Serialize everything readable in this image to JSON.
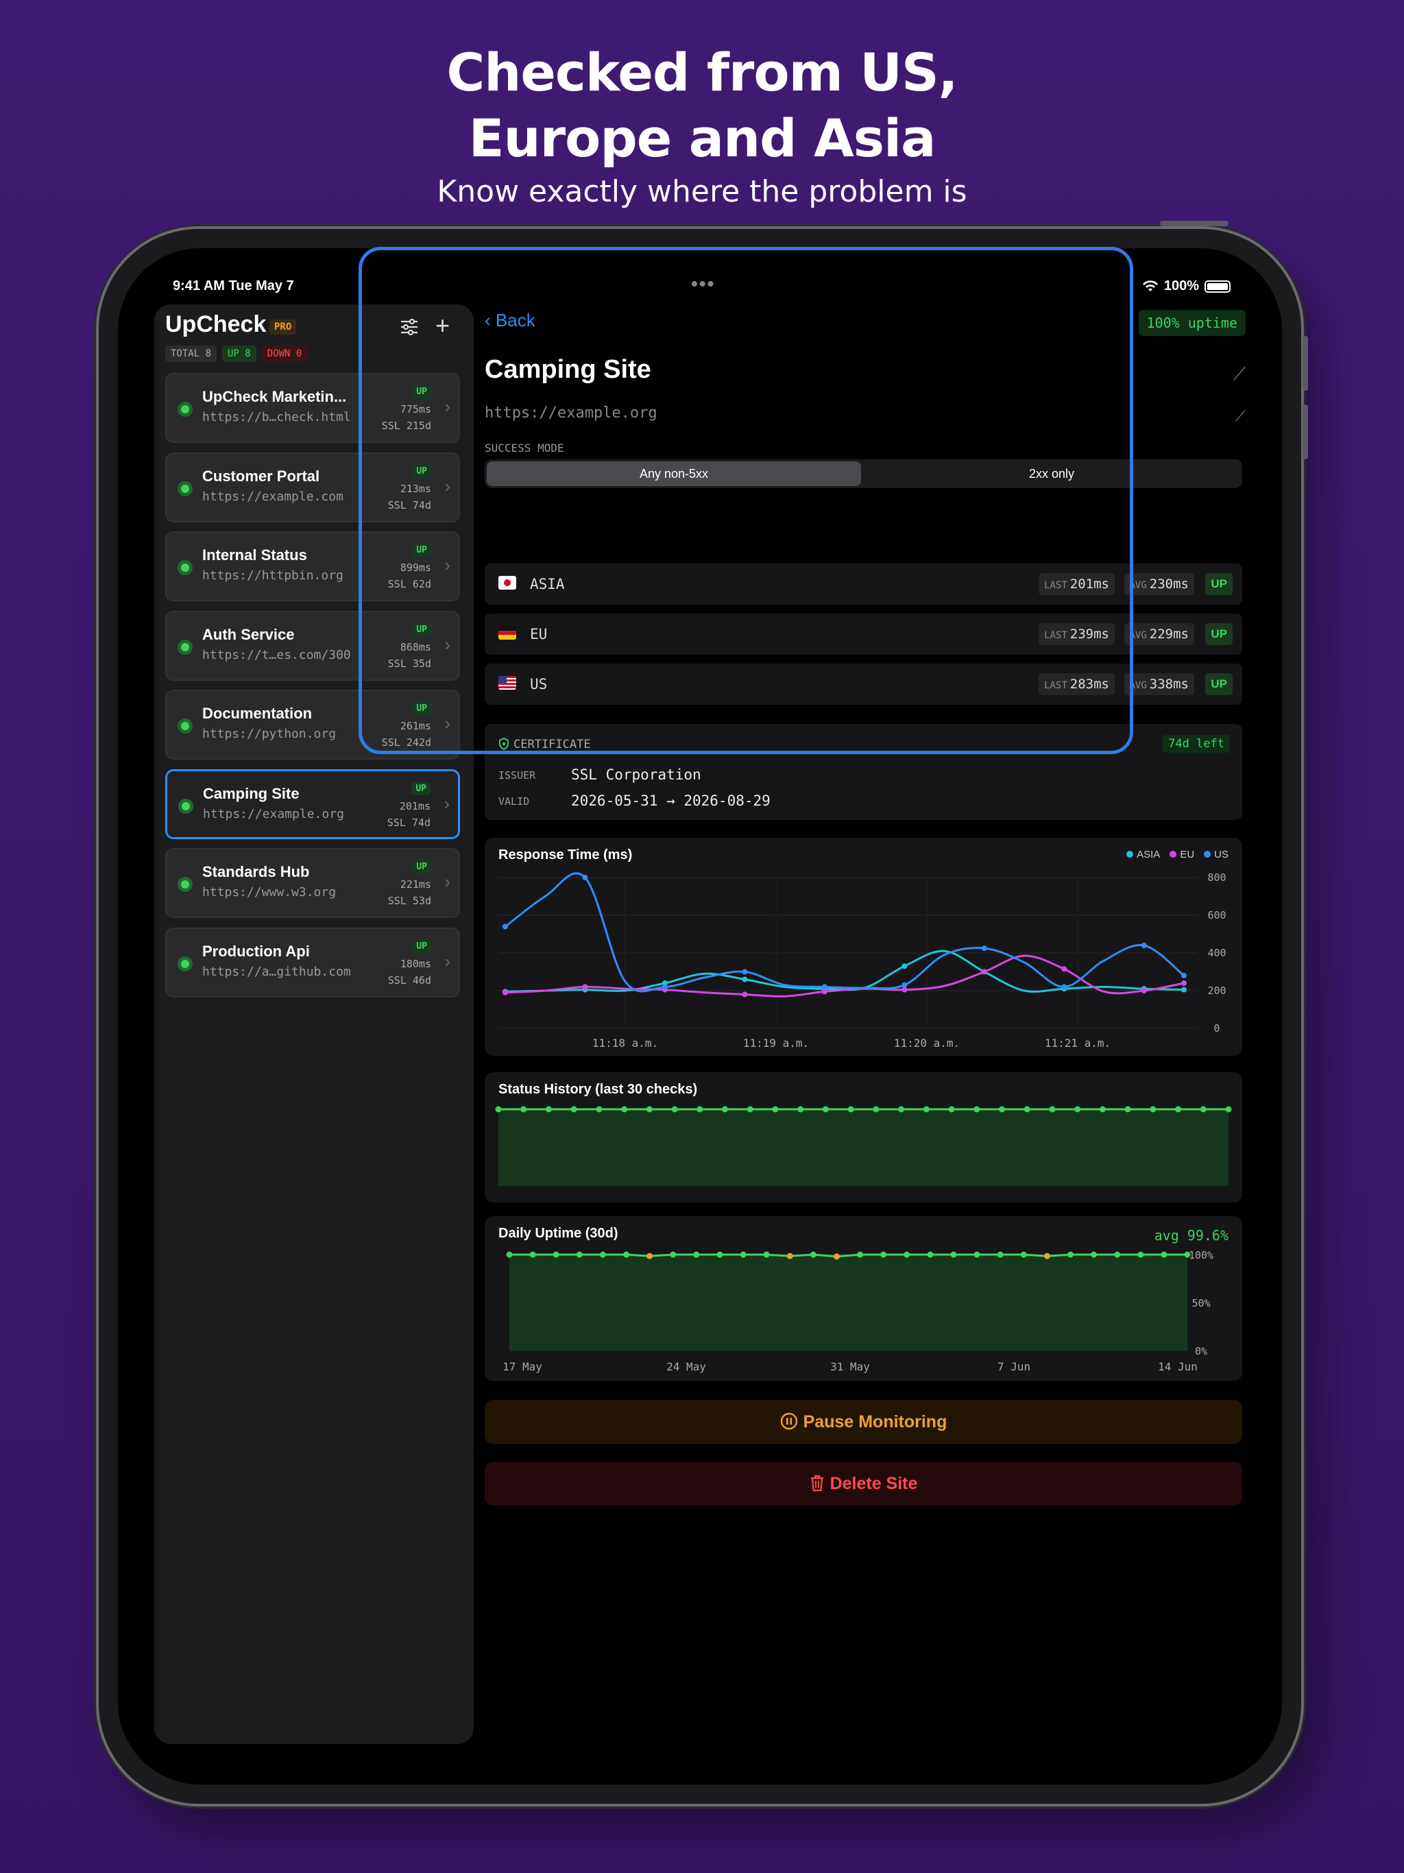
{
  "marketing": {
    "headline_line1": "Checked from US,",
    "headline_line2": "Europe and Asia",
    "subline": "Know exactly where the problem is"
  },
  "status_bar": {
    "time": "9:41 AM  Tue May 7",
    "battery": "100%"
  },
  "sidebar": {
    "title": "UpCheck",
    "badge": "PRO",
    "pills": {
      "total": "TOTAL 8",
      "up": "UP 8",
      "down": "DOWN 0"
    },
    "sites": [
      {
        "name": "UpCheck Marketin...",
        "url": "https://b…check.html",
        "status": "UP",
        "ms": "775ms",
        "ssl": "SSL 215d"
      },
      {
        "name": "Customer Portal",
        "url": "https://example.com",
        "status": "UP",
        "ms": "213ms",
        "ssl": "SSL 74d"
      },
      {
        "name": "Internal Status",
        "url": "https://httpbin.org",
        "status": "UP",
        "ms": "899ms",
        "ssl": "SSL 62d"
      },
      {
        "name": "Auth Service",
        "url": "https://t…es.com/300",
        "status": "UP",
        "ms": "868ms",
        "ssl": "SSL 35d"
      },
      {
        "name": "Documentation",
        "url": "https://python.org",
        "status": "UP",
        "ms": "261ms",
        "ssl": "SSL 242d"
      },
      {
        "name": "Camping Site",
        "url": "https://example.org",
        "status": "UP",
        "ms": "201ms",
        "ssl": "SSL 74d"
      },
      {
        "name": "Standards Hub",
        "url": "https://www.w3.org",
        "status": "UP",
        "ms": "221ms",
        "ssl": "SSL 53d"
      },
      {
        "name": "Production Api",
        "url": "https://a…github.com",
        "status": "UP",
        "ms": "180ms",
        "ssl": "SSL 46d"
      }
    ]
  },
  "detail": {
    "back_label": "Back",
    "uptime_badge": "100% uptime",
    "title": "Camping Site",
    "url": "https://example.org",
    "success_mode_label": "SUCCESS MODE",
    "success_mode_options": [
      "Any non-5xx",
      "2xx only"
    ],
    "regions": [
      {
        "name": "ASIA",
        "last_label": "LAST",
        "last": "201ms",
        "avg_label": "AVG",
        "avg": "230ms",
        "status": "UP"
      },
      {
        "name": "EU",
        "last_label": "LAST",
        "last": "239ms",
        "avg_label": "AVG",
        "avg": "229ms",
        "status": "UP"
      },
      {
        "name": "US",
        "last_label": "LAST",
        "last": "283ms",
        "avg_label": "AVG",
        "avg": "338ms",
        "status": "UP"
      }
    ],
    "certificate": {
      "label": "CERTIFICATE",
      "days_left": "74d left",
      "issuer_label": "ISSUER",
      "issuer": "SSL Corporation",
      "valid_label": "VALID",
      "valid": "2026-05-31 → 2026-08-29"
    },
    "pause_label": "Pause Monitoring",
    "delete_label": "Delete Site"
  },
  "colors": {
    "accent": "#2f8ef5",
    "up": "#3ed45e",
    "asia": "#1fc6d6",
    "eu": "#d648e6",
    "us": "#2f8ef5",
    "orange": "#f0a030",
    "red": "#ff4b4b"
  },
  "chart_data": [
    {
      "type": "line",
      "title": "Response Time (ms)",
      "ylim": [
        0,
        800
      ],
      "yticks": [
        0,
        200,
        400,
        600,
        800
      ],
      "xtick_labels": [
        "11:18 a.m.",
        "11:19 a.m.",
        "11:20 a.m.",
        "11:21 a.m."
      ],
      "legend": "top-right",
      "series": [
        {
          "name": "ASIA",
          "color": "#1fc6d6",
          "values": [
            195,
            200,
            205,
            200,
            240,
            290,
            260,
            220,
            210,
            215,
            330,
            410,
            300,
            200,
            210,
            220,
            210,
            205
          ]
        },
        {
          "name": "EU",
          "color": "#d648e6",
          "values": [
            190,
            200,
            220,
            210,
            205,
            190,
            180,
            170,
            195,
            210,
            205,
            225,
            300,
            385,
            315,
            195,
            200,
            240
          ]
        },
        {
          "name": "US",
          "color": "#2f8ef5",
          "values": [
            540,
            700,
            800,
            250,
            220,
            270,
            300,
            230,
            220,
            215,
            230,
            390,
            425,
            350,
            220,
            360,
            440,
            280
          ]
        }
      ]
    },
    {
      "type": "line",
      "title": "Status History (last 30 checks)",
      "ylim": [
        0,
        1
      ],
      "series": [
        {
          "name": "",
          "color": "#3ed45e",
          "values": [
            1,
            1,
            1,
            1,
            1,
            1,
            1,
            1,
            1,
            1,
            1,
            1,
            1,
            1,
            1,
            1,
            1,
            1,
            1,
            1,
            1,
            1,
            1,
            1,
            1,
            1,
            1,
            1,
            1,
            1
          ]
        }
      ]
    },
    {
      "type": "area",
      "title": "Daily Uptime (30d)",
      "summary": "avg 99.6%",
      "ylim": [
        0,
        100
      ],
      "ytick_labels": [
        "100%",
        "50%",
        "0%"
      ],
      "xtick_labels": [
        "17 May",
        "24 May",
        "31 May",
        "7 Jun",
        "14 Jun"
      ],
      "series": [
        {
          "name": "",
          "color": "#3ed45e",
          "values": [
            100,
            100,
            100,
            100,
            100,
            100,
            98.5,
            100,
            100,
            100,
            100,
            100,
            98.5,
            100,
            98,
            100,
            100,
            100,
            100,
            100,
            100,
            100,
            100,
            98.5,
            100,
            100,
            100,
            100,
            100,
            100
          ]
        }
      ],
      "dip_color": "#f0a030"
    }
  ]
}
